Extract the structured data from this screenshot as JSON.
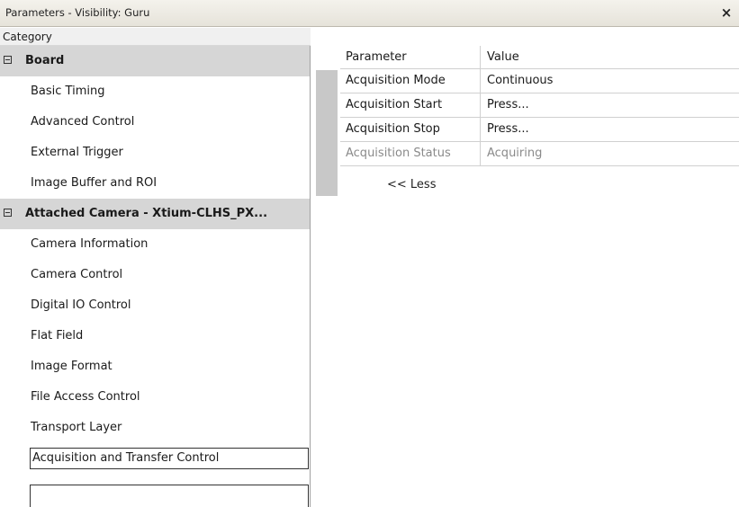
{
  "window": {
    "title": "Parameters - Visibility: Guru",
    "close_glyph": "×"
  },
  "category": {
    "header": "Category",
    "items": [
      {
        "label": "Board",
        "type": "group"
      },
      {
        "label": "Basic Timing",
        "type": "item"
      },
      {
        "label": "Advanced Control",
        "type": "item"
      },
      {
        "label": "External Trigger",
        "type": "item"
      },
      {
        "label": "Image Buffer and ROI",
        "type": "item"
      },
      {
        "label": "Attached Camera - Xtium-CLHS_PX...",
        "type": "group"
      },
      {
        "label": "Camera Information",
        "type": "item"
      },
      {
        "label": "Camera Control",
        "type": "item"
      },
      {
        "label": "Digital IO Control",
        "type": "item"
      },
      {
        "label": "Flat Field",
        "type": "item"
      },
      {
        "label": "Image Format",
        "type": "item"
      },
      {
        "label": "File Access Control",
        "type": "item"
      },
      {
        "label": "Transport Layer",
        "type": "item"
      },
      {
        "label": "Acquisition and Transfer Control",
        "type": "item",
        "selected": true
      }
    ]
  },
  "parameters": {
    "col_parameter": "Parameter",
    "col_value": "Value",
    "rows": [
      {
        "name": "Acquisition Mode",
        "value": "Continuous",
        "enabled": true
      },
      {
        "name": "Acquisition Start",
        "value": "Press...",
        "enabled": true
      },
      {
        "name": "Acquisition Stop",
        "value": "Press...",
        "enabled": true
      },
      {
        "name": "Acquisition Status",
        "value": "Acquiring",
        "enabled": false
      }
    ],
    "less_link": "<< Less"
  }
}
